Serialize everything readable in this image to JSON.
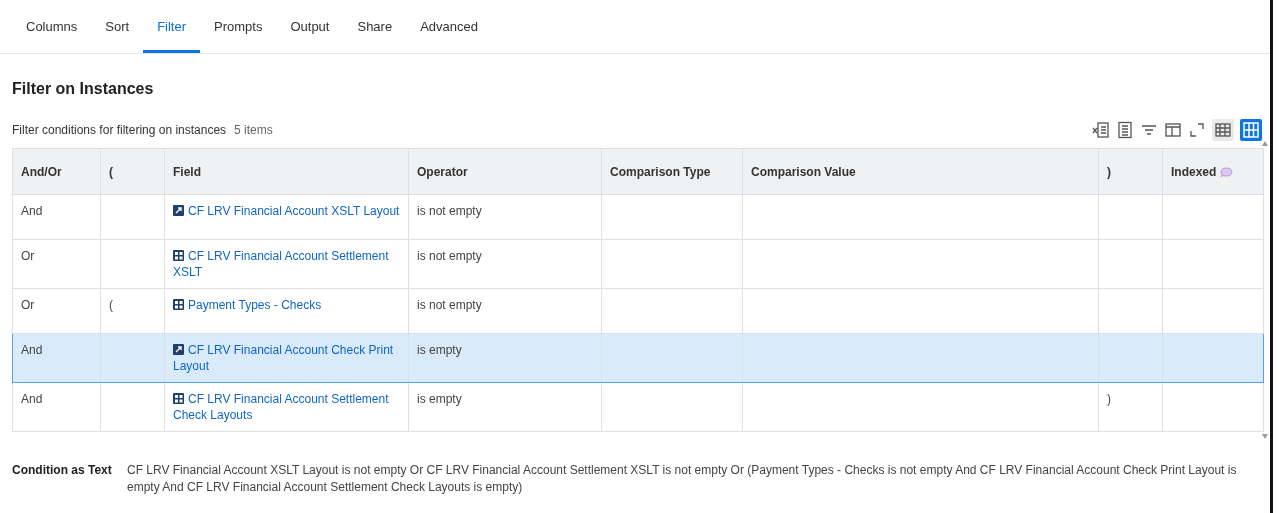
{
  "tabs": [
    {
      "label": "Columns",
      "selected": false
    },
    {
      "label": "Sort",
      "selected": false
    },
    {
      "label": "Filter",
      "selected": true
    },
    {
      "label": "Prompts",
      "selected": false
    },
    {
      "label": "Output",
      "selected": false
    },
    {
      "label": "Share",
      "selected": false
    },
    {
      "label": "Advanced",
      "selected": false
    }
  ],
  "section_title": "Filter on Instances",
  "grid": {
    "caption": "Filter conditions for filtering on instances",
    "count": "5 items",
    "view_toggle": [
      {
        "kind": "table",
        "selected": false
      },
      {
        "kind": "grid",
        "selected": true
      }
    ],
    "columns": [
      "And/Or",
      "(",
      "Field",
      "Operator",
      "Comparison Type",
      "Comparison Value",
      ")",
      "Indexed"
    ],
    "rows": [
      {
        "and_or": "And",
        "open_paren": "",
        "field": {
          "kind": "single",
          "text": "CF LRV Financial Account XSLT Layout"
        },
        "operator": "is not empty",
        "close_paren": "",
        "selected": false
      },
      {
        "and_or": "Or",
        "open_paren": "",
        "field": {
          "kind": "multi",
          "text": "CF LRV Financial Account Settlement XSLT"
        },
        "operator": "is not empty",
        "close_paren": "",
        "selected": false
      },
      {
        "and_or": "Or",
        "open_paren": "(",
        "field": {
          "kind": "multi",
          "text": "Payment Types - Checks"
        },
        "operator": "is not empty",
        "close_paren": "",
        "selected": false
      },
      {
        "and_or": "And",
        "open_paren": "",
        "field": {
          "kind": "single",
          "text": "CF LRV Financial Account Check Print Layout"
        },
        "operator": "is empty",
        "close_paren": "",
        "selected": true
      },
      {
        "and_or": "And",
        "open_paren": "",
        "field": {
          "kind": "multi",
          "text": "CF LRV Financial Account Settlement Check Layouts"
        },
        "operator": "is empty",
        "close_paren": ")",
        "selected": false
      }
    ]
  },
  "condition_as_text": {
    "label": "Condition as Text",
    "value": "CF LRV Financial Account XSLT Layout is not empty Or CF LRV Financial Account Settlement XSLT is not empty Or (Payment Types - Checks is not empty And CF LRV Financial Account Check Print Layout is empty And CF LRV Financial Account Settlement Check Layouts is empty)"
  }
}
